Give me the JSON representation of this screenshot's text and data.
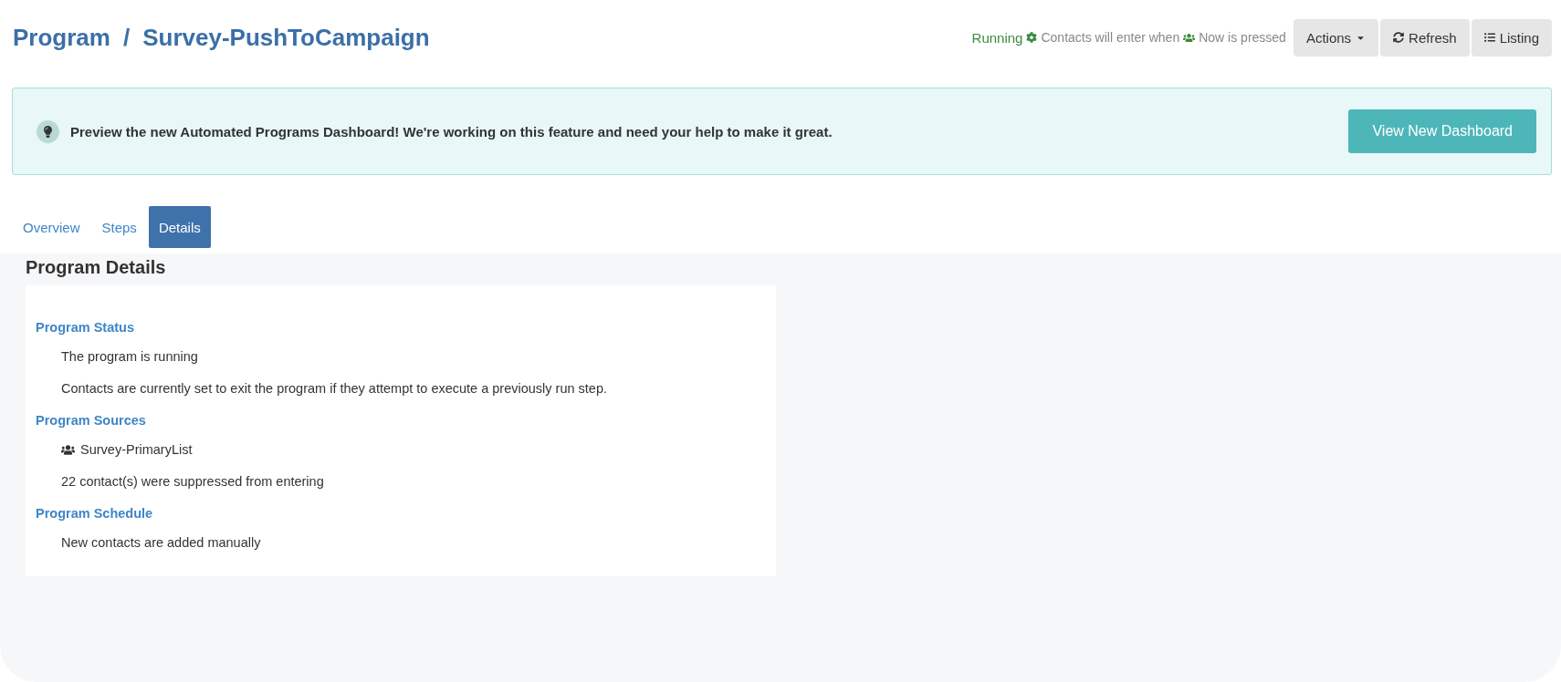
{
  "breadcrumb": {
    "root": "Program",
    "separator": "/",
    "current": "Survey-PushToCampaign"
  },
  "status": {
    "state": "Running",
    "before": "Contacts will enter when",
    "after": "Now is pressed"
  },
  "actions": [
    {
      "label": "Actions",
      "kind": "dropdown"
    },
    {
      "label": "Refresh",
      "kind": "refresh"
    },
    {
      "label": "Listing",
      "kind": "listing"
    }
  ],
  "banner": {
    "message": "Preview the new Automated Programs Dashboard! We're working on this feature and need your help to make it great.",
    "button": "View New Dashboard"
  },
  "tabs": [
    {
      "label": "Overview",
      "selected": false
    },
    {
      "label": "Steps",
      "selected": false
    },
    {
      "label": "Details",
      "selected": true
    }
  ],
  "details": {
    "title": "Program Details",
    "sections": [
      {
        "heading": "Program Status",
        "lines": [
          {
            "kind": "text",
            "text": "The program is running"
          },
          {
            "kind": "text",
            "text": "Contacts are currently set to exit the program if they attempt to execute a previously run step."
          }
        ]
      },
      {
        "heading": "Program Sources",
        "lines": [
          {
            "kind": "list",
            "text": "Survey-PrimaryList"
          },
          {
            "kind": "text",
            "text": "22 contact(s) were suppressed from entering"
          }
        ]
      },
      {
        "heading": "Program Schedule",
        "lines": [
          {
            "kind": "text",
            "text": "New contacts are added manually"
          }
        ]
      }
    ]
  }
}
